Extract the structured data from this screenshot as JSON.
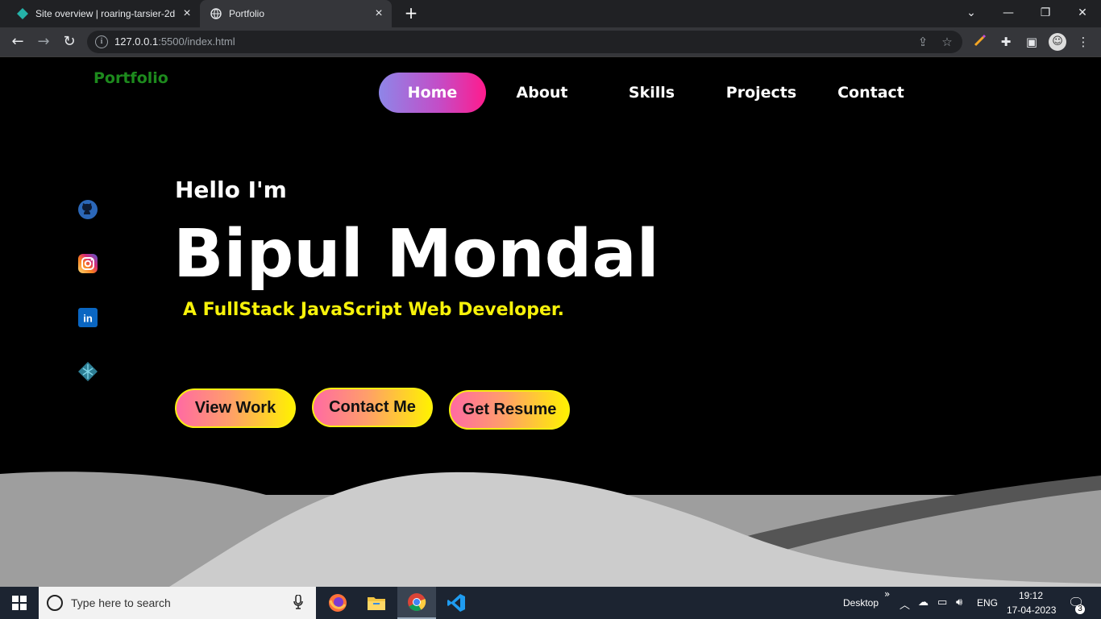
{
  "browser": {
    "tabs": [
      {
        "title": "Site overview | roaring-tarsier-2d",
        "icon": "netlify-favicon"
      },
      {
        "title": "Portfolio",
        "icon": "globe-icon"
      }
    ],
    "url_host": "127.0.0.1",
    "url_path": ":5500/index.html"
  },
  "site": {
    "logo": "Portfolio",
    "nav": [
      "Home",
      "About",
      "Skills",
      "Projects",
      "Contact"
    ],
    "nav_active": "Home",
    "social": [
      "github-icon",
      "instagram-icon",
      "linkedin-icon",
      "netlify-icon"
    ],
    "hero": {
      "greeting": "Hello I'm",
      "name": "Bipul Mondal",
      "tagline": "A FullStack JavaScript Web Developer."
    },
    "buttons": [
      "View Work",
      "Contact Me",
      "Get Resume"
    ],
    "colors": {
      "logo": "#1d8a1d",
      "tagline": "#f7f20a",
      "wave_light": "#cccccc",
      "wave_mid": "#9e9e9e"
    }
  },
  "taskbar": {
    "search_placeholder": "Type here to search",
    "desktop_label": "Desktop",
    "language": "ENG",
    "time": "19:12",
    "date": "17-04-2023",
    "notifications": "3"
  }
}
